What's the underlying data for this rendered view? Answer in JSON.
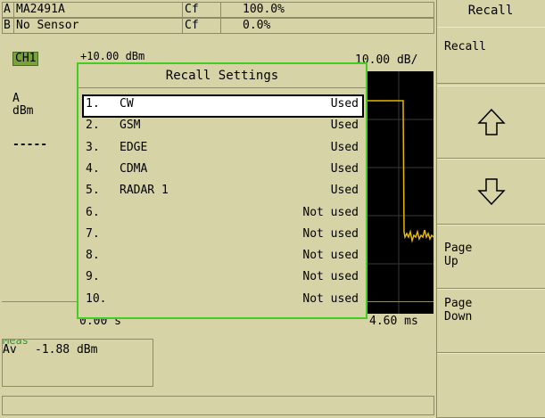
{
  "sensor_a": {
    "channel": "A",
    "model": "MA2491A",
    "cf_label": "Cf",
    "cf_value": "100.0%"
  },
  "sensor_b": {
    "channel": "B",
    "model": "No Sensor",
    "cf_label": "Cf",
    "cf_value": "0.0%"
  },
  "channel_label": "CH1",
  "top_value_left": "+10.00 dBm",
  "top_value_right": "10.00 dB/",
  "left_panel": {
    "sensor": "A",
    "unit": "dBm",
    "marker": "-----"
  },
  "time_start": "0.00 s",
  "time_end": "4.60 ms",
  "meas": {
    "label": "Meas",
    "mode": "Av",
    "value": "-1.88 dBm"
  },
  "dialog": {
    "title": "Recall Settings",
    "rows": [
      {
        "num": "1.",
        "name": "CW",
        "status": "Used"
      },
      {
        "num": "2.",
        "name": "GSM",
        "status": "Used"
      },
      {
        "num": "3.",
        "name": "EDGE",
        "status": "Used"
      },
      {
        "num": "4.",
        "name": "CDMA",
        "status": "Used"
      },
      {
        "num": "5.",
        "name": "RADAR 1",
        "status": "Used"
      },
      {
        "num": "6.",
        "name": "",
        "status": "Not used"
      },
      {
        "num": "7.",
        "name": "",
        "status": "Not used"
      },
      {
        "num": "8.",
        "name": "",
        "status": "Not used"
      },
      {
        "num": "9.",
        "name": "",
        "status": "Not used"
      },
      {
        "num": "10.",
        "name": "",
        "status": "Not used"
      }
    ]
  },
  "softkeys": {
    "menu_title": "Recall",
    "recall": "Recall",
    "up_icon": "arrow-up-icon",
    "down_icon": "arrow-down-icon",
    "page_up_1": "Page",
    "page_up_2": "Up",
    "page_down_1": "Page",
    "page_down_2": "Down"
  },
  "colors": {
    "background": "#d6d3a6",
    "dialog_border": "#44cc22",
    "trace": "#e6b800",
    "plot_bg": "#000000",
    "channel_tag": "#7aa23a"
  }
}
